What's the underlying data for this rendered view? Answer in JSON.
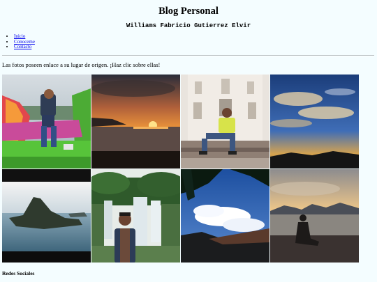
{
  "header": {
    "title": "Blog Personal",
    "author": "Williams Fabricio Gutierrez Elvir"
  },
  "nav": {
    "items": [
      {
        "label": "Inicio"
      },
      {
        "label": "Conoceme"
      },
      {
        "label": "Contacto"
      }
    ]
  },
  "intro": "Las fotos poseen enlace a su lugar de origen. ¡Haz clic sobre ellas!",
  "gallery": {
    "photos": [
      {
        "subject": "man-on-colorful-bridge"
      },
      {
        "subject": "sunset-over-lake"
      },
      {
        "subject": "man-in-front-of-white-church"
      },
      {
        "subject": "blue-sky-with-clouds-at-dusk"
      },
      {
        "subject": "volcano-island-in-lake"
      },
      {
        "subject": "man-at-waterfall"
      },
      {
        "subject": "palm-silhouette-and-sky"
      },
      {
        "subject": "person-silhouette-on-shore"
      }
    ]
  },
  "footer": {
    "social_heading": "Redes Sociales"
  },
  "colors": {
    "background": "#f4fdff",
    "link": "#0000ee",
    "divider": "#b8c0c2"
  }
}
